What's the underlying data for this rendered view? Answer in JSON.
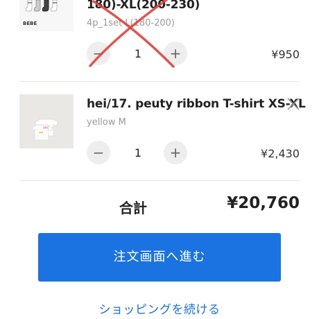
{
  "cart": {
    "items": [
      {
        "title": "180)-XL(200-230)",
        "variant": "4p_1set L(180-200)",
        "quantity": "1",
        "price": "¥950",
        "minus": "−",
        "plus": "+",
        "thumb_logo": "BEBE",
        "strike_color": "#e0413a"
      },
      {
        "title": "hei/17. peuty ribbon T-shirt XS-XL",
        "variant": "yellow M",
        "quantity": "1",
        "price": "¥2,430",
        "minus": "−",
        "plus": "+"
      }
    ]
  },
  "summary": {
    "total_label": "合計",
    "total_value": "¥20,760"
  },
  "actions": {
    "checkout_label": "注文画面へ進む",
    "continue_label": "ショッピングを続ける",
    "accent_color": "#1a73e0"
  },
  "icons": {
    "remove": "close-icon"
  }
}
